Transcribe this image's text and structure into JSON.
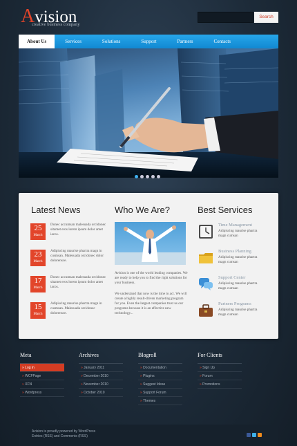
{
  "brand": {
    "first_letter": "A",
    "rest": "vision",
    "tagline": "creative business company"
  },
  "search": {
    "button_label": "Search",
    "placeholder": ""
  },
  "nav": [
    "About Us",
    "Services",
    "Solutions",
    "Support",
    "Partners",
    "Contacts"
  ],
  "slider": {
    "dots": 5,
    "active_index": 0
  },
  "latest_news": {
    "title": "Latest News",
    "items": [
      {
        "day": "25",
        "month": "March",
        "text": "Donec accumsan malesuada orcidonec sitamet eros lorem ipsum dolor amet iacos."
      },
      {
        "day": "23",
        "month": "March",
        "text": "Adipiscing maurise phartra magn in cusmsan. Malesuada orcidonec dolor dolorensce."
      },
      {
        "day": "17",
        "month": "March",
        "text": "Donec accumsan malesuada orcidonec sitamet eros lorem ipsum dolor amet iacos."
      },
      {
        "day": "15",
        "month": "March",
        "text": "Adipiscing maurise phartra magn in cusmsan. Malesuada orcidonec dolorensce."
      }
    ]
  },
  "who_we_are": {
    "title": "Who We Are?",
    "paragraph1": "Avision is one of the world leading companies. We are ready to help you to find the right solutions for your business.",
    "paragraph2": "We understand that now is the time to act. We will create a highly result-driven marketing program for you. Even the largest companies trust us our programs because it is an effective new technology..."
  },
  "best_services": {
    "title": "Best Services",
    "items": [
      {
        "title": "Time Management",
        "text": "Adipiscing maurise phartra magn cumsan",
        "icon": "clock-icon"
      },
      {
        "title": "Business Planning",
        "text": "Adipiscing maurise phartra magn cumsan",
        "icon": "folder-icon"
      },
      {
        "title": "Support Center",
        "text": "Adipiscing maurise phartra magn cumsan",
        "icon": "chat-icon"
      },
      {
        "title": "Partners Programs",
        "text": "Adipiscing maurise phartra magn cumsan",
        "icon": "briefcase-icon"
      }
    ]
  },
  "footer": {
    "meta": {
      "title": "Meta",
      "items": [
        "Log in",
        "WCFPage",
        "XFN",
        "Wordpress"
      ]
    },
    "archives": {
      "title": "Archives",
      "items": [
        "January 2011",
        "December 2010",
        "November 2010",
        "October 2010"
      ]
    },
    "blogroll": {
      "title": "Blogroll",
      "items": [
        "Documentation",
        "Plugins",
        "Suggest Ideas",
        "Support Forum",
        "Themes"
      ]
    },
    "clients": {
      "title": "For Clients",
      "items": [
        "Sign Up",
        "Forum",
        "Promotions"
      ]
    },
    "copyright_line1": "Avision is proudly powered by WordPress",
    "copyright_line2": "Entries (RSS) and Comments (RSS)"
  },
  "colors": {
    "accent": "#e2452a",
    "nav_blue": "#1a97df",
    "background": "#1c2a38"
  }
}
